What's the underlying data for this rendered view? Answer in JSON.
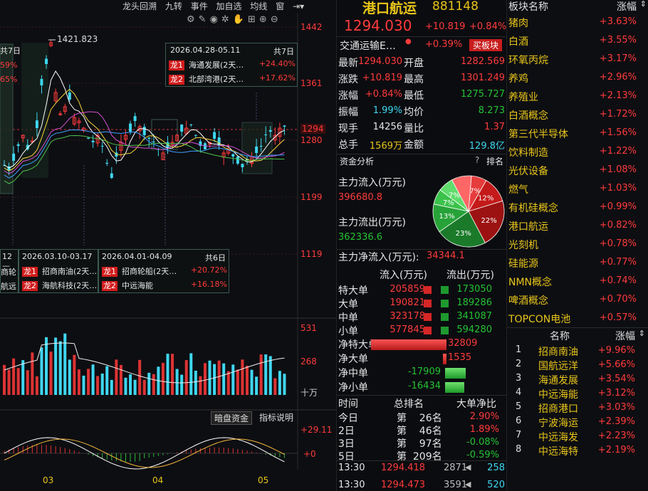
{
  "toolbar": {
    "items": [
      "龙头回溯",
      "九转",
      "事件",
      "加自选",
      "均线",
      "窗"
    ]
  },
  "chart": {
    "price_high_label": "1421.823",
    "y_labels": [
      "1442",
      "1361",
      "1294",
      "1280",
      "1199",
      "1119"
    ],
    "vol_labels": [
      "531",
      "268",
      "十万"
    ],
    "macd_labels": [
      "+29.11",
      "+0"
    ],
    "x_labels": [
      "03",
      "04",
      "05"
    ],
    "left_clip_labels": [
      "共7日",
      "59%",
      "65%"
    ],
    "popup1": {
      "range": "2026.04.28-05.11",
      "days": "共7日",
      "rows": [
        {
          "tag": "龙1",
          "name": "海通发展(2天…",
          "pct": "+24.40%"
        },
        {
          "tag": "龙2",
          "name": "北部湾港(2天…",
          "pct": "+17.62%"
        }
      ]
    },
    "popup2": {
      "range": "2026.03.10-03.17",
      "rows": [
        {
          "tag": "龙1",
          "name": "招商南油(2天…"
        },
        {
          "tag": "龙2",
          "name": "海航科技(2天…"
        }
      ]
    },
    "popup3": {
      "range": "2026.04.01-04.09",
      "days": "共6日",
      "rows": [
        {
          "tag": "龙1",
          "name": "招商轮船(2天…",
          "pct": "+20.72%"
        },
        {
          "tag": "龙2",
          "name": "中远海能",
          "pct": "+16.18%"
        }
      ]
    },
    "popup0_left": {
      "range": "12—",
      "rows": [
        "商轮",
        "航远"
      ]
    },
    "macd_buttons": [
      "暗盘资金",
      "指标说明"
    ]
  },
  "quote": {
    "name": "港口航运",
    "code": "881148",
    "price": "1294.030",
    "chg": "+10.819",
    "pct": "+0.84%",
    "sector": "交通运输E…",
    "sector_pct": "+0.39%",
    "buy_btn": "买板块",
    "rows": [
      {
        "l1": "最新",
        "v1": "1294.030",
        "l2": "开盘",
        "v2": "1282.569"
      },
      {
        "l1": "涨跌",
        "v1": "+10.819",
        "l2": "最高",
        "v2": "1301.249"
      },
      {
        "l1": "涨幅",
        "v1": "+0.84%",
        "l2": "最低",
        "v2": "1275.727"
      },
      {
        "l1": "振幅",
        "v1": "1.99%",
        "l2": "均价",
        "v2": "8.273"
      },
      {
        "l1": "现手",
        "v1": "14256",
        "l2": "量比",
        "v2": "1.37"
      },
      {
        "l1": "总手",
        "v1": "1569万",
        "l2": "金额",
        "v2": "129.8亿"
      }
    ],
    "fund_title": "资金分析",
    "fund_rank": "排名",
    "help": "?",
    "inflow_label": "主力流入(万元)",
    "inflow": "396680.8",
    "outflow_label": "主力流出(万元)",
    "outflow": "362336.6",
    "net_label": "主力净流入(万元):",
    "net": "34344.1",
    "pie": [
      {
        "label": "7%",
        "v": 7,
        "color": "#e63c3c"
      },
      {
        "label": "12%",
        "v": 12,
        "color": "#c41a1a"
      },
      {
        "label": "22%",
        "v": 22,
        "color": "#9c1212"
      },
      {
        "label": "23%",
        "v": 23,
        "color": "#1a7a2a"
      },
      {
        "label": "13%",
        "v": 13,
        "color": "#27a238"
      },
      {
        "label": "7%",
        "v": 7,
        "color": "#3bc24b"
      },
      {
        "label": "7%",
        "v": 7,
        "color": "#5fdc6b"
      },
      {
        "label": "",
        "v": 9,
        "color": "#ff6666"
      }
    ],
    "flow_head": [
      "流入(万元)",
      "流出(万元)"
    ],
    "flows": [
      {
        "l": "特大单",
        "in": "205859",
        "out": "173050"
      },
      {
        "l": "大单",
        "in": "190821",
        "out": "189286"
      },
      {
        "l": "中单",
        "in": "323178",
        "out": "341087"
      },
      {
        "l": "小单",
        "in": "577845",
        "out": "594280"
      }
    ],
    "nets": [
      {
        "l": "净特大单",
        "v": "32809",
        "n": 32809
      },
      {
        "l": "净大单",
        "v": "1535",
        "n": 1535
      },
      {
        "l": "净中单",
        "v": "-17909",
        "n": -17909
      },
      {
        "l": "净小单",
        "v": "-16434",
        "n": -16434
      }
    ],
    "rank_head": [
      "时间",
      "总排名",
      "大单净比"
    ],
    "ranks": [
      {
        "t": "今日",
        "r": "第    26名",
        "p": "2.90%"
      },
      {
        "t": "2日",
        "r": "第    46名",
        "p": "1.89%"
      },
      {
        "t": "3日",
        "r": "第    97名",
        "p": "-0.08%"
      },
      {
        "t": "5日",
        "r": "第  209名",
        "p": "-0.59%"
      }
    ],
    "ticks": [
      {
        "t": "13:30",
        "p": "1294.418",
        "v": "2871",
        "n": "258"
      },
      {
        "t": "13:30",
        "p": "1294.473",
        "v": "3591",
        "n": "520"
      }
    ]
  },
  "sectors": {
    "head_name": "板块名称",
    "head_pct": "涨幅",
    "items": [
      [
        "猪肉",
        "+3.63%"
      ],
      [
        "白酒",
        "+3.55%"
      ],
      [
        "环氧丙烷",
        "+3.17%"
      ],
      [
        "养鸡",
        "+2.96%"
      ],
      [
        "养殖业",
        "+2.13%"
      ],
      [
        "白酒概念",
        "+1.72%"
      ],
      [
        "第三代半导体",
        "+1.56%"
      ],
      [
        "饮料制造",
        "+1.22%"
      ],
      [
        "光伏设备",
        "+1.08%"
      ],
      [
        "燃气",
        "+1.03%"
      ],
      [
        "有机硅概念",
        "+0.99%"
      ],
      [
        "港口航运",
        "+0.82%"
      ],
      [
        "光刻机",
        "+0.78%"
      ],
      [
        "硅能源",
        "+0.77%"
      ],
      [
        "NMN概念",
        "+0.74%"
      ],
      [
        "啤酒概念",
        "+0.70%"
      ],
      [
        "TOPCON电池",
        "+0.57%"
      ]
    ]
  },
  "stocks": {
    "head_name": "名称",
    "head_pct": "涨幅",
    "items": [
      [
        "1",
        "招商南油",
        "+9.96%"
      ],
      [
        "2",
        "国航远洋",
        "+5.66%"
      ],
      [
        "3",
        "海通发展",
        "+3.54%"
      ],
      [
        "4",
        "中远海能",
        "+3.12%"
      ],
      [
        "5",
        "招商港口",
        "+3.03%"
      ],
      [
        "6",
        "宁波海运",
        "+2.39%"
      ],
      [
        "7",
        "中远海发",
        "+2.23%"
      ],
      [
        "8",
        "中远海特",
        "+2.19%"
      ]
    ]
  }
}
